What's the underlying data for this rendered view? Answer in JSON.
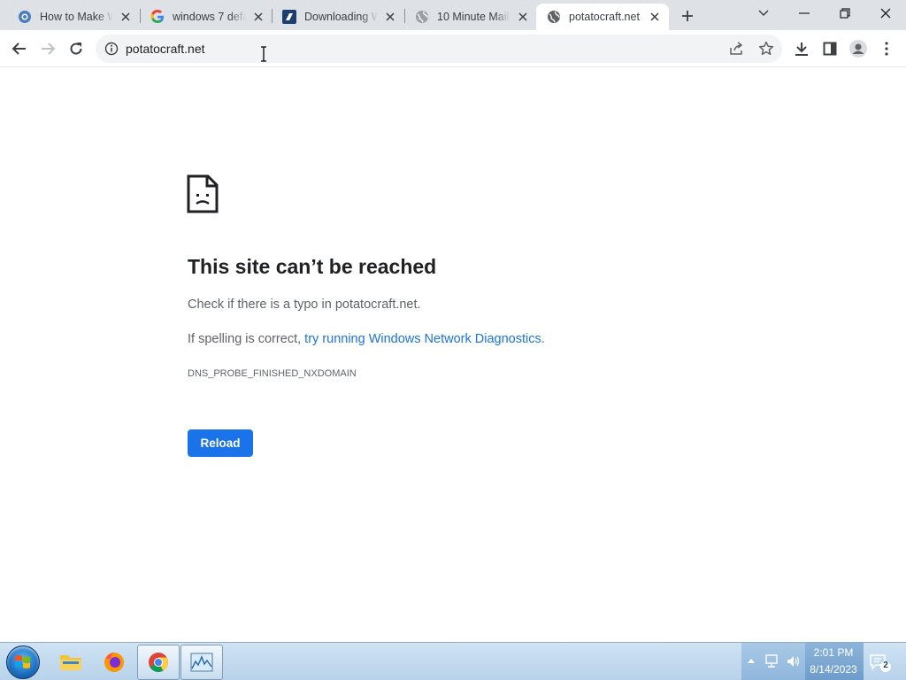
{
  "browser": {
    "tabs": [
      {
        "title": "How to Make W",
        "favicon": "how-to-icon",
        "active": false
      },
      {
        "title": "windows 7 defa",
        "favicon": "google-icon",
        "active": false
      },
      {
        "title": "Downloading W",
        "favicon": "downloading-site-icon",
        "active": false
      },
      {
        "title": "10 Minute Mail",
        "favicon": "globe-icon",
        "active": false
      },
      {
        "title": "potatocraft.net",
        "favicon": "globe-icon",
        "active": true
      }
    ],
    "url": "potatocraft.net"
  },
  "error": {
    "title": "This site can’t be reached",
    "line1": "Check if there is a typo in potatocraft.net.",
    "line2_prefix": "If spelling is correct, ",
    "line2_link": "try running Windows Network Diagnostics",
    "line2_suffix": ".",
    "code": "DNS_PROBE_FINISHED_NXDOMAIN",
    "reload_label": "Reload"
  },
  "taskbar": {
    "apps": [
      "file-explorer-icon",
      "firefox-icon",
      "chrome-icon",
      "resource-monitor-icon"
    ],
    "time": "2:01 PM",
    "date": "8/14/2023",
    "notification_count": "2"
  },
  "colors": {
    "accent": "#1a73e8",
    "tabstrip": "#dee1e6"
  }
}
